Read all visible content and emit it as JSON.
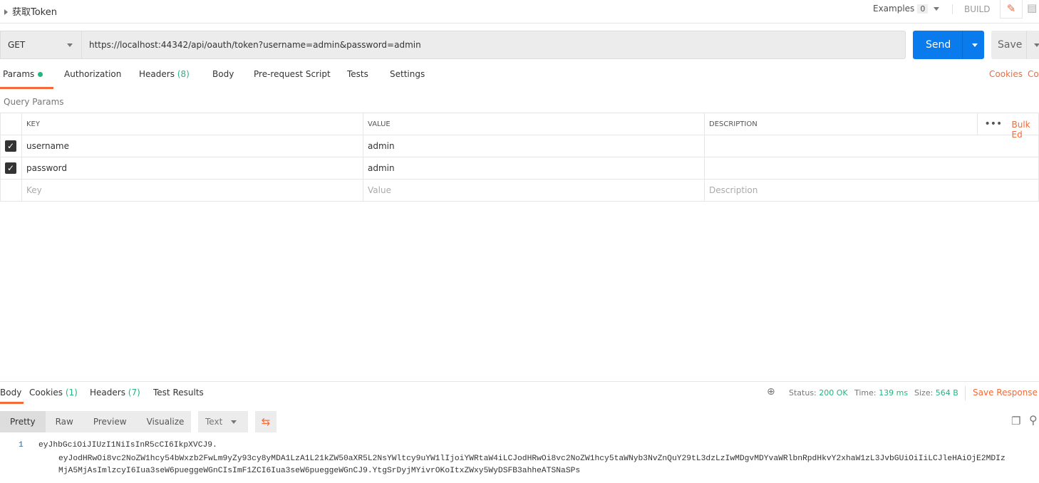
{
  "header": {
    "title": "获取Token",
    "examples_label": "Examples",
    "examples_count": "0",
    "build_label": "BUILD",
    "edit_icon": "pencil-icon",
    "comment_icon": "comment-icon"
  },
  "request": {
    "method": "GET",
    "url": "https://localhost:44342/api/oauth/token?username=admin&password=admin",
    "send_label": "Send",
    "save_label": "Save"
  },
  "request_tabs": [
    {
      "label": "Params"
    },
    {
      "label": "Authorization"
    },
    {
      "label": "Headers",
      "count": "(8)"
    },
    {
      "label": "Body"
    },
    {
      "label": "Pre-request Script"
    },
    {
      "label": "Tests"
    },
    {
      "label": "Settings"
    }
  ],
  "cookies_label": "Cookies",
  "code_label": "Co",
  "query_params": {
    "title": "Query Params",
    "columns": [
      "KEY",
      "VALUE",
      "DESCRIPTION"
    ],
    "bulk_edit": "Bulk Ed",
    "rows": [
      {
        "checked": true,
        "key": "username",
        "value": "admin",
        "description": ""
      },
      {
        "checked": true,
        "key": "password",
        "value": "admin",
        "description": ""
      }
    ],
    "placeholders": {
      "key": "Key",
      "value": "Value",
      "description": "Description"
    }
  },
  "response": {
    "tabs": [
      {
        "label": "Body"
      },
      {
        "label": "Cookies",
        "count": "(1)"
      },
      {
        "label": "Headers",
        "count": "(7)"
      },
      {
        "label": "Test Results"
      }
    ],
    "status_label": "Status:",
    "status": "200 OK",
    "time_label": "Time:",
    "time": "139 ms",
    "size_label": "Size:",
    "size": "564 B",
    "save_response": "Save Response",
    "formats": [
      "Pretty",
      "Raw",
      "Preview",
      "Visualize"
    ],
    "type": "Text",
    "line_number": "1",
    "body_lines": [
      "eyJhbGciOiJIUzI1NiIsInR5cCI6IkpXVCJ9.",
      "eyJodHRwOi8vc2NoZW1hcy54bWxzb2FwLm9yZy93cy8yMDA1LzA1L21kZW50aXR5L2NsYWltcy9uYW1lIjoiYWRtaW4iLCJodHRwOi8vc2NoZW1hcy5taWNyb3NvZnQuY29tL3dzLzIwMDgvMDYvaWRlbnRpdHkvY2xhaW1zL3JvbGUiOiIiLCJleHAiOjE2MDIz",
      "MjA5MjAsImlzcyI6Iua3seW6pueggeWGnCIsImF1ZCI6Iua3seW6pueggeWGnCJ9.YtgSrDyjMYivrOKoItxZWxy5WyDSFB3ahheATSNaSPs"
    ]
  },
  "colors": {
    "accent": "#f26b3a",
    "send": "#097bed",
    "success": "#26b47f"
  }
}
